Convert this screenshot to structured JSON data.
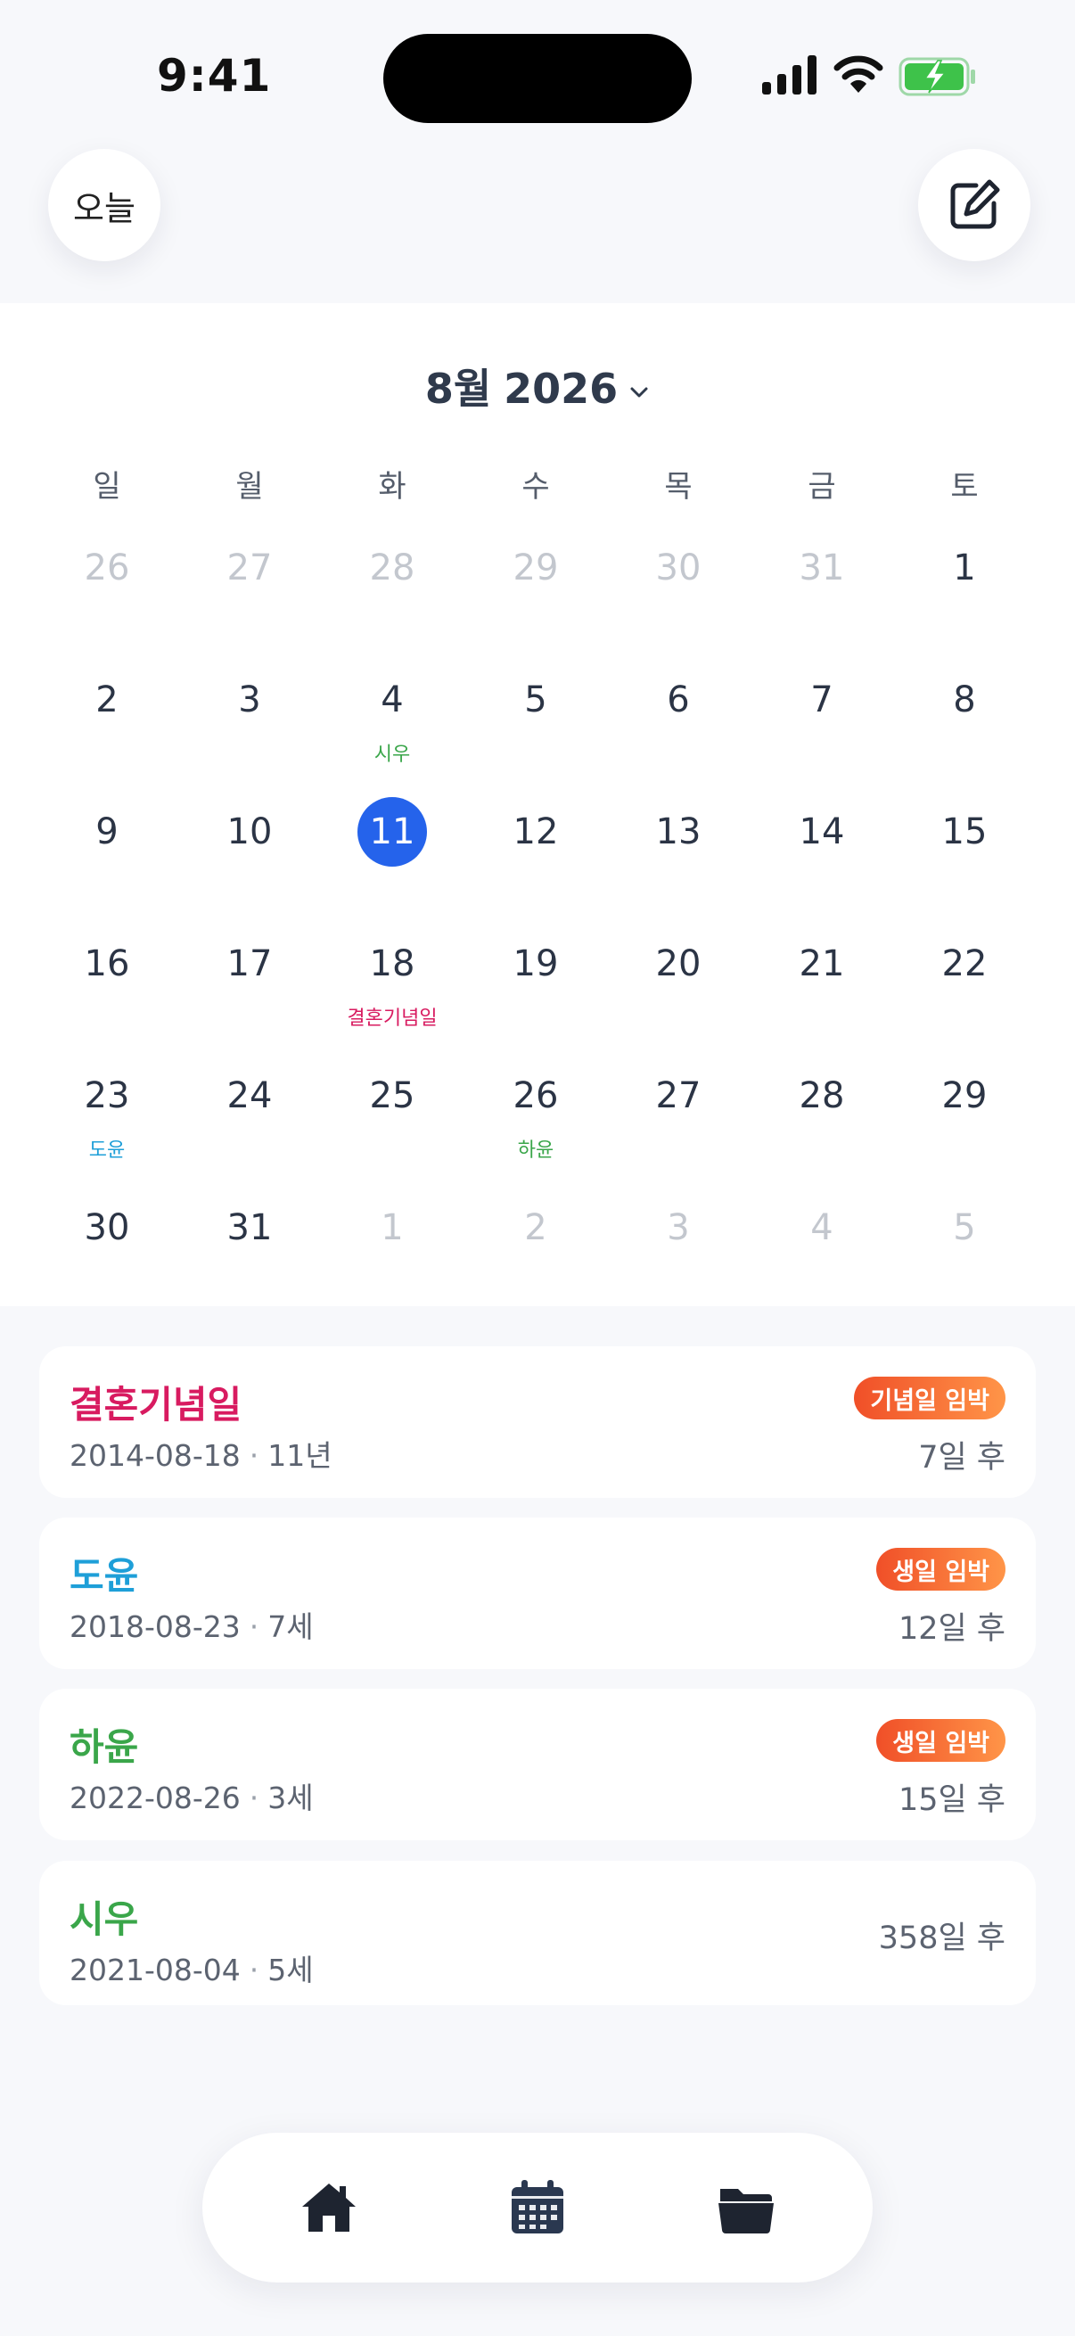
{
  "status_bar": {
    "time": "9:41"
  },
  "header": {
    "today_label": "오늘"
  },
  "calendar": {
    "month": "8월",
    "year": "2026",
    "weekdays": [
      "일",
      "월",
      "화",
      "수",
      "목",
      "금",
      "토"
    ],
    "weeks": [
      [
        {
          "d": "26",
          "muted": true
        },
        {
          "d": "27",
          "muted": true
        },
        {
          "d": "28",
          "muted": true
        },
        {
          "d": "29",
          "muted": true
        },
        {
          "d": "30",
          "muted": true
        },
        {
          "d": "31",
          "muted": true
        },
        {
          "d": "1"
        }
      ],
      [
        {
          "d": "2"
        },
        {
          "d": "3"
        },
        {
          "d": "4",
          "event": "시우",
          "color": "#3aa64a"
        },
        {
          "d": "5"
        },
        {
          "d": "6"
        },
        {
          "d": "7"
        },
        {
          "d": "8"
        }
      ],
      [
        {
          "d": "9"
        },
        {
          "d": "10"
        },
        {
          "d": "11",
          "selected": true
        },
        {
          "d": "12"
        },
        {
          "d": "13"
        },
        {
          "d": "14"
        },
        {
          "d": "15"
        }
      ],
      [
        {
          "d": "16"
        },
        {
          "d": "17"
        },
        {
          "d": "18",
          "event": "결혼기념일",
          "color": "#d81b60"
        },
        {
          "d": "19"
        },
        {
          "d": "20"
        },
        {
          "d": "21"
        },
        {
          "d": "22"
        }
      ],
      [
        {
          "d": "23",
          "event": "도윤",
          "color": "#1e9fd8"
        },
        {
          "d": "24"
        },
        {
          "d": "25"
        },
        {
          "d": "26",
          "event": "하윤",
          "color": "#3aa64a"
        },
        {
          "d": "27"
        },
        {
          "d": "28"
        },
        {
          "d": "29"
        }
      ],
      [
        {
          "d": "30"
        },
        {
          "d": "31"
        },
        {
          "d": "1",
          "muted": true
        },
        {
          "d": "2",
          "muted": true
        },
        {
          "d": "3",
          "muted": true
        },
        {
          "d": "4",
          "muted": true
        },
        {
          "d": "5",
          "muted": true
        }
      ]
    ]
  },
  "events": [
    {
      "name": "결혼기념일",
      "color": "#d81b60",
      "date": "2014-08-18",
      "detail": "11년",
      "badge": "기념일 임박",
      "dday": "7일 후"
    },
    {
      "name": "도윤",
      "color": "#1e9fd8",
      "date": "2018-08-23",
      "detail": "7세",
      "badge": "생일 임박",
      "dday": "12일 후"
    },
    {
      "name": "하윤",
      "color": "#3aa64a",
      "date": "2022-08-26",
      "detail": "3세",
      "badge": "생일 임박",
      "dday": "15일 후"
    },
    {
      "name": "시우",
      "color": "#3aa64a",
      "date": "2021-08-04",
      "detail": "5세",
      "badge": "",
      "dday": "358일 후"
    }
  ],
  "meta_separator": "·",
  "colors": {
    "accent": "#2563eb",
    "badge_start": "#f04f28",
    "badge_end": "#ff9548"
  },
  "tabs": [
    {
      "icon": "home-icon",
      "active": false
    },
    {
      "icon": "calendar-icon",
      "active": true
    },
    {
      "icon": "folder-icon",
      "active": false
    }
  ]
}
